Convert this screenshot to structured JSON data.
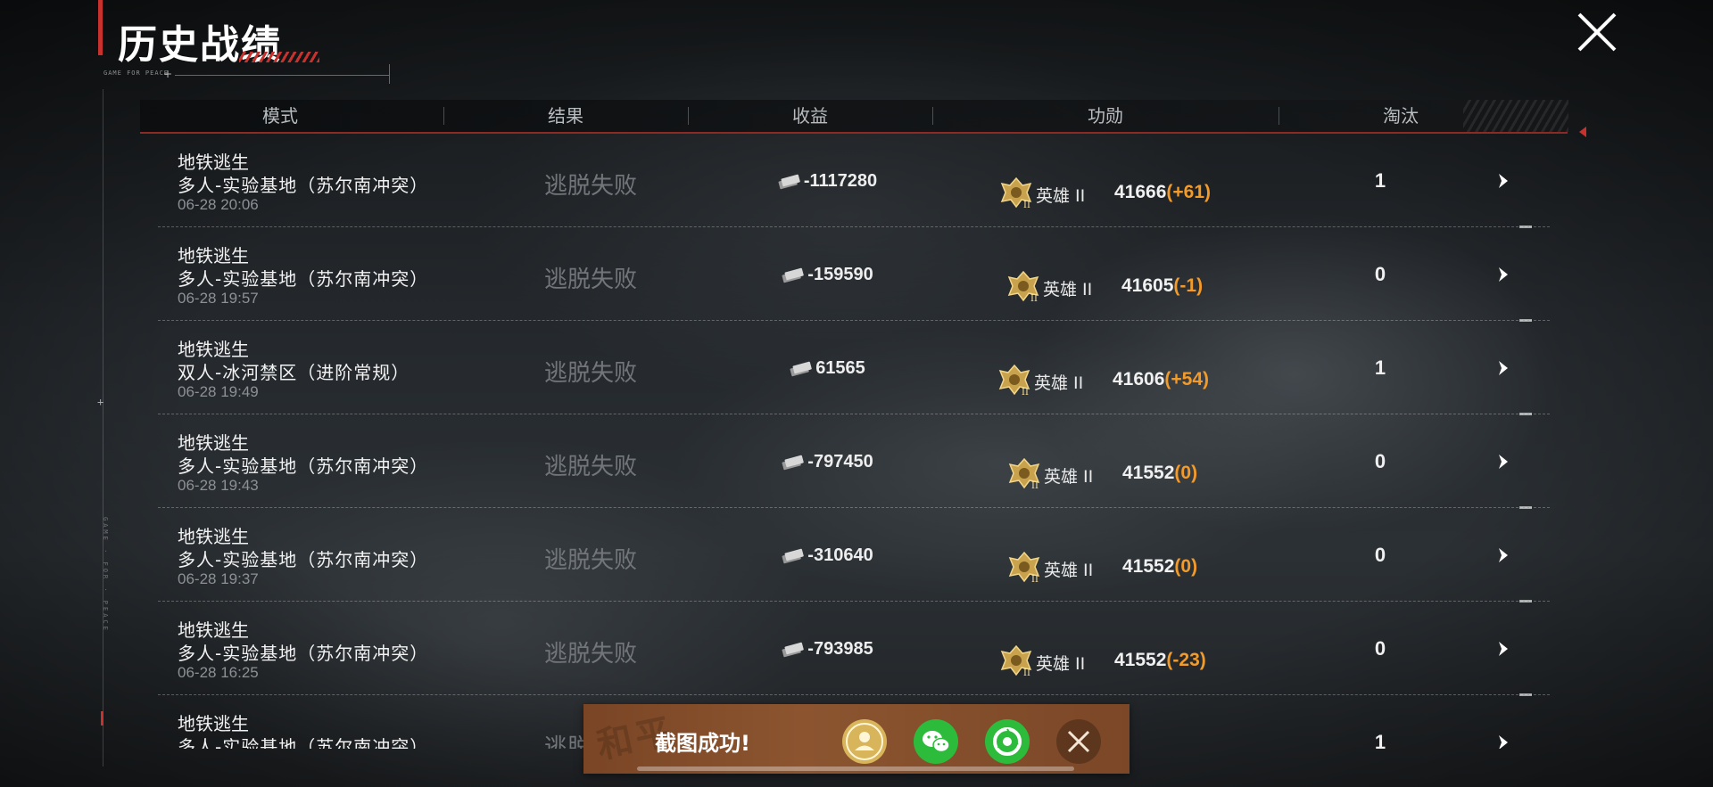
{
  "header": {
    "title": "历史战绩",
    "subtitle": "GAME FOR PEACE"
  },
  "left_deco_text": "GAME · FOR · PEACE",
  "table": {
    "columns": [
      "模式",
      "结果",
      "收益",
      "功勋",
      "淘汰"
    ],
    "rows": [
      {
        "mode": "地铁逃生",
        "map": "多人-实验基地（苏尔南冲突）",
        "time": "06-28 20:06",
        "result": "逃脱失败",
        "income": "-1117280",
        "rank": "英雄 II",
        "merit": "41666",
        "delta": "(+61)",
        "eliminations": "1"
      },
      {
        "mode": "地铁逃生",
        "map": "多人-实验基地（苏尔南冲突）",
        "time": "06-28 19:57",
        "result": "逃脱失败",
        "income": "-159590",
        "rank": "英雄 II",
        "merit": "41605",
        "delta": "(-1)",
        "eliminations": "0"
      },
      {
        "mode": "地铁逃生",
        "map": "双人-冰河禁区（进阶常规）",
        "time": "06-28 19:49",
        "result": "逃脱失败",
        "income": "61565",
        "rank": "英雄 II",
        "merit": "41606",
        "delta": "(+54)",
        "eliminations": "1"
      },
      {
        "mode": "地铁逃生",
        "map": "多人-实验基地（苏尔南冲突）",
        "time": "06-28 19:43",
        "result": "逃脱失败",
        "income": "-797450",
        "rank": "英雄 II",
        "merit": "41552",
        "delta": "(0)",
        "eliminations": "0"
      },
      {
        "mode": "地铁逃生",
        "map": "多人-实验基地（苏尔南冲突）",
        "time": "06-28 19:37",
        "result": "逃脱失败",
        "income": "-310640",
        "rank": "英雄 II",
        "merit": "41552",
        "delta": "(0)",
        "eliminations": "0"
      },
      {
        "mode": "地铁逃生",
        "map": "多人-实验基地（苏尔南冲突）",
        "time": "06-28 16:25",
        "result": "逃脱失败",
        "income": "-793985",
        "rank": "英雄 II",
        "merit": "41552",
        "delta": "(-23)",
        "eliminations": "0"
      },
      {
        "mode": "地铁逃生",
        "map": "多人-实验基地（苏尔南冲突）",
        "time": "",
        "result": "逃脱失败",
        "income": "",
        "rank": "",
        "merit": "",
        "delta": "",
        "eliminations": "1"
      }
    ]
  },
  "toast": {
    "text": "截图成功!",
    "watermark": "和平"
  },
  "colors": {
    "accent_red": "#c8322e",
    "delta_orange": "#f29a2a",
    "toast_bg": "#8c5530",
    "wechat_green": "#2dbb3c",
    "gold": "#d8b45a"
  }
}
